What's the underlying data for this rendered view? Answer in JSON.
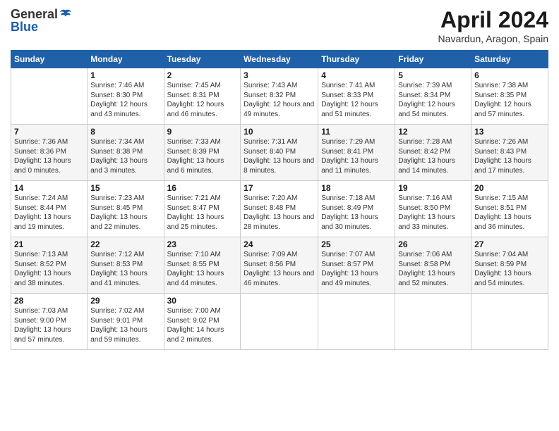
{
  "header": {
    "logo_line1": "General",
    "logo_line2": "Blue",
    "month_title": "April 2024",
    "location": "Navardun, Aragon, Spain"
  },
  "calendar": {
    "columns": [
      "Sunday",
      "Monday",
      "Tuesday",
      "Wednesday",
      "Thursday",
      "Friday",
      "Saturday"
    ],
    "weeks": [
      [
        {
          "day": "",
          "sunrise": "",
          "sunset": "",
          "daylight": ""
        },
        {
          "day": "1",
          "sunrise": "Sunrise: 7:46 AM",
          "sunset": "Sunset: 8:30 PM",
          "daylight": "Daylight: 12 hours and 43 minutes."
        },
        {
          "day": "2",
          "sunrise": "Sunrise: 7:45 AM",
          "sunset": "Sunset: 8:31 PM",
          "daylight": "Daylight: 12 hours and 46 minutes."
        },
        {
          "day": "3",
          "sunrise": "Sunrise: 7:43 AM",
          "sunset": "Sunset: 8:32 PM",
          "daylight": "Daylight: 12 hours and 49 minutes."
        },
        {
          "day": "4",
          "sunrise": "Sunrise: 7:41 AM",
          "sunset": "Sunset: 8:33 PM",
          "daylight": "Daylight: 12 hours and 51 minutes."
        },
        {
          "day": "5",
          "sunrise": "Sunrise: 7:39 AM",
          "sunset": "Sunset: 8:34 PM",
          "daylight": "Daylight: 12 hours and 54 minutes."
        },
        {
          "day": "6",
          "sunrise": "Sunrise: 7:38 AM",
          "sunset": "Sunset: 8:35 PM",
          "daylight": "Daylight: 12 hours and 57 minutes."
        }
      ],
      [
        {
          "day": "7",
          "sunrise": "Sunrise: 7:36 AM",
          "sunset": "Sunset: 8:36 PM",
          "daylight": "Daylight: 13 hours and 0 minutes."
        },
        {
          "day": "8",
          "sunrise": "Sunrise: 7:34 AM",
          "sunset": "Sunset: 8:38 PM",
          "daylight": "Daylight: 13 hours and 3 minutes."
        },
        {
          "day": "9",
          "sunrise": "Sunrise: 7:33 AM",
          "sunset": "Sunset: 8:39 PM",
          "daylight": "Daylight: 13 hours and 6 minutes."
        },
        {
          "day": "10",
          "sunrise": "Sunrise: 7:31 AM",
          "sunset": "Sunset: 8:40 PM",
          "daylight": "Daylight: 13 hours and 8 minutes."
        },
        {
          "day": "11",
          "sunrise": "Sunrise: 7:29 AM",
          "sunset": "Sunset: 8:41 PM",
          "daylight": "Daylight: 13 hours and 11 minutes."
        },
        {
          "day": "12",
          "sunrise": "Sunrise: 7:28 AM",
          "sunset": "Sunset: 8:42 PM",
          "daylight": "Daylight: 13 hours and 14 minutes."
        },
        {
          "day": "13",
          "sunrise": "Sunrise: 7:26 AM",
          "sunset": "Sunset: 8:43 PM",
          "daylight": "Daylight: 13 hours and 17 minutes."
        }
      ],
      [
        {
          "day": "14",
          "sunrise": "Sunrise: 7:24 AM",
          "sunset": "Sunset: 8:44 PM",
          "daylight": "Daylight: 13 hours and 19 minutes."
        },
        {
          "day": "15",
          "sunrise": "Sunrise: 7:23 AM",
          "sunset": "Sunset: 8:45 PM",
          "daylight": "Daylight: 13 hours and 22 minutes."
        },
        {
          "day": "16",
          "sunrise": "Sunrise: 7:21 AM",
          "sunset": "Sunset: 8:47 PM",
          "daylight": "Daylight: 13 hours and 25 minutes."
        },
        {
          "day": "17",
          "sunrise": "Sunrise: 7:20 AM",
          "sunset": "Sunset: 8:48 PM",
          "daylight": "Daylight: 13 hours and 28 minutes."
        },
        {
          "day": "18",
          "sunrise": "Sunrise: 7:18 AM",
          "sunset": "Sunset: 8:49 PM",
          "daylight": "Daylight: 13 hours and 30 minutes."
        },
        {
          "day": "19",
          "sunrise": "Sunrise: 7:16 AM",
          "sunset": "Sunset: 8:50 PM",
          "daylight": "Daylight: 13 hours and 33 minutes."
        },
        {
          "day": "20",
          "sunrise": "Sunrise: 7:15 AM",
          "sunset": "Sunset: 8:51 PM",
          "daylight": "Daylight: 13 hours and 36 minutes."
        }
      ],
      [
        {
          "day": "21",
          "sunrise": "Sunrise: 7:13 AM",
          "sunset": "Sunset: 8:52 PM",
          "daylight": "Daylight: 13 hours and 38 minutes."
        },
        {
          "day": "22",
          "sunrise": "Sunrise: 7:12 AM",
          "sunset": "Sunset: 8:53 PM",
          "daylight": "Daylight: 13 hours and 41 minutes."
        },
        {
          "day": "23",
          "sunrise": "Sunrise: 7:10 AM",
          "sunset": "Sunset: 8:55 PM",
          "daylight": "Daylight: 13 hours and 44 minutes."
        },
        {
          "day": "24",
          "sunrise": "Sunrise: 7:09 AM",
          "sunset": "Sunset: 8:56 PM",
          "daylight": "Daylight: 13 hours and 46 minutes."
        },
        {
          "day": "25",
          "sunrise": "Sunrise: 7:07 AM",
          "sunset": "Sunset: 8:57 PM",
          "daylight": "Daylight: 13 hours and 49 minutes."
        },
        {
          "day": "26",
          "sunrise": "Sunrise: 7:06 AM",
          "sunset": "Sunset: 8:58 PM",
          "daylight": "Daylight: 13 hours and 52 minutes."
        },
        {
          "day": "27",
          "sunrise": "Sunrise: 7:04 AM",
          "sunset": "Sunset: 8:59 PM",
          "daylight": "Daylight: 13 hours and 54 minutes."
        }
      ],
      [
        {
          "day": "28",
          "sunrise": "Sunrise: 7:03 AM",
          "sunset": "Sunset: 9:00 PM",
          "daylight": "Daylight: 13 hours and 57 minutes."
        },
        {
          "day": "29",
          "sunrise": "Sunrise: 7:02 AM",
          "sunset": "Sunset: 9:01 PM",
          "daylight": "Daylight: 13 hours and 59 minutes."
        },
        {
          "day": "30",
          "sunrise": "Sunrise: 7:00 AM",
          "sunset": "Sunset: 9:02 PM",
          "daylight": "Daylight: 14 hours and 2 minutes."
        },
        {
          "day": "",
          "sunrise": "",
          "sunset": "",
          "daylight": ""
        },
        {
          "day": "",
          "sunrise": "",
          "sunset": "",
          "daylight": ""
        },
        {
          "day": "",
          "sunrise": "",
          "sunset": "",
          "daylight": ""
        },
        {
          "day": "",
          "sunrise": "",
          "sunset": "",
          "daylight": ""
        }
      ]
    ]
  }
}
